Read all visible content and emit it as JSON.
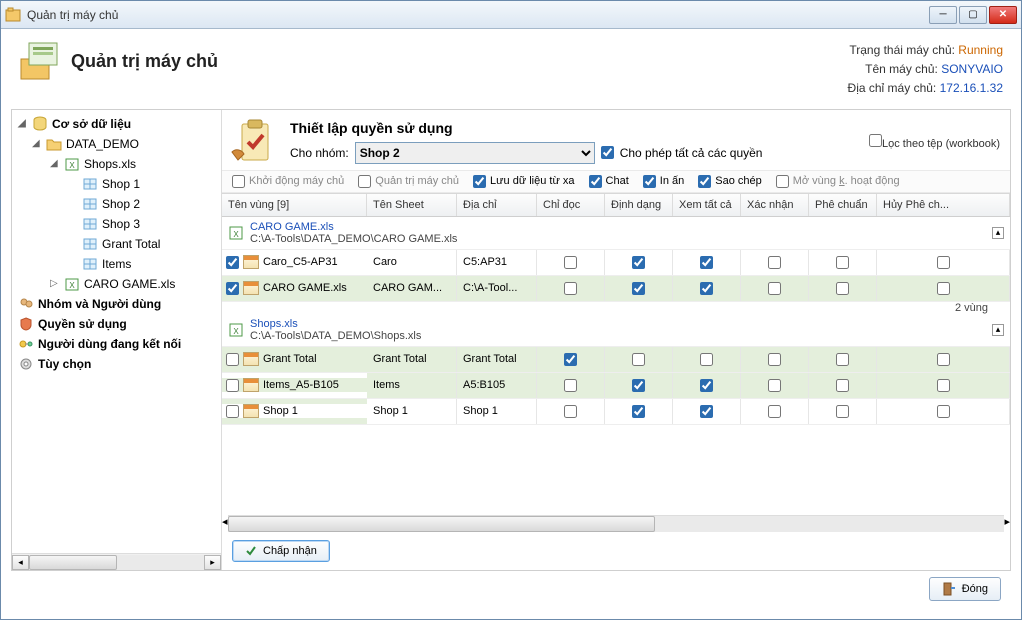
{
  "window": {
    "title": "Quản trị máy chủ"
  },
  "header": {
    "title": "Quản trị máy chủ",
    "status_label": "Trạng thái máy chủ:",
    "status_value": "Running",
    "name_label": "Tên máy chủ:",
    "name_value": "SONYVAIO",
    "addr_label": "Địa chỉ máy chủ:",
    "addr_value": "172.16.1.32"
  },
  "sidebar": {
    "root": "Cơ sở dữ liệu",
    "folder": "DATA_DEMO",
    "file1": "Shops.xls",
    "sh1": "Shop 1",
    "sh2": "Shop 2",
    "sh3": "Shop 3",
    "gt": "Grant Total",
    "items": "Items",
    "file2": "CARO GAME.xls",
    "nav1": "Nhóm và Người dùng",
    "nav2": "Quyền sử dụng",
    "nav3": "Người dùng đang kết nối",
    "nav4": "Tùy chọn"
  },
  "panel": {
    "title": "Thiết lập quyền sử dụng",
    "for_group": "Cho nhóm:",
    "group_value": "Shop 2",
    "allow_all": "Cho phép tất cả các quyền",
    "filter_book": "Lọc theo tệp (workbook)"
  },
  "perms": {
    "start": "Khởi động máy chủ",
    "admin": "Quản trị máy chủ",
    "remote": "Lưu dữ liệu từ xa",
    "chat": "Chat",
    "print": "In ấn",
    "copy": "Sao chép",
    "open_inactive": "Mở vùng k. hoạt động"
  },
  "grid": {
    "h_name": "Tên vùng [9]",
    "h_sheet": "Tên Sheet",
    "h_addr": "Địa chỉ",
    "h_ro": "Chỉ đọc",
    "h_fmt": "Định dạng",
    "h_va": "Xem tất cả",
    "h_cf": "Xác nhận",
    "h_ap": "Phê chuẩn",
    "h_rj": "Hủy Phê ch...",
    "g1_name": "CARO GAME.xls",
    "g1_path": "C:\\A-Tools\\DATA_DEMO\\CARO GAME.xls",
    "r1_name": "Caro_C5-AP31",
    "r1_sheet": "Caro",
    "r1_addr": "C5:AP31",
    "r2_name": "CARO GAME.xls",
    "r2_sheet": "CARO GAM...",
    "r2_addr": "C:\\A-Tool...",
    "g1_count": "2 vùng",
    "g2_name": "Shops.xls",
    "g2_path": "C:\\A-Tools\\DATA_DEMO\\Shops.xls",
    "r3_name": "Grant Total",
    "r3_sheet": "Grant Total",
    "r3_addr": "Grant Total",
    "r4_name": "Items_A5-B105",
    "r4_sheet": "Items",
    "r4_addr": "A5:B105",
    "r5_name": "Shop 1",
    "r5_sheet": "Shop 1",
    "r5_addr": "Shop 1"
  },
  "buttons": {
    "accept": "Chấp nhận",
    "close": "Đóng"
  }
}
